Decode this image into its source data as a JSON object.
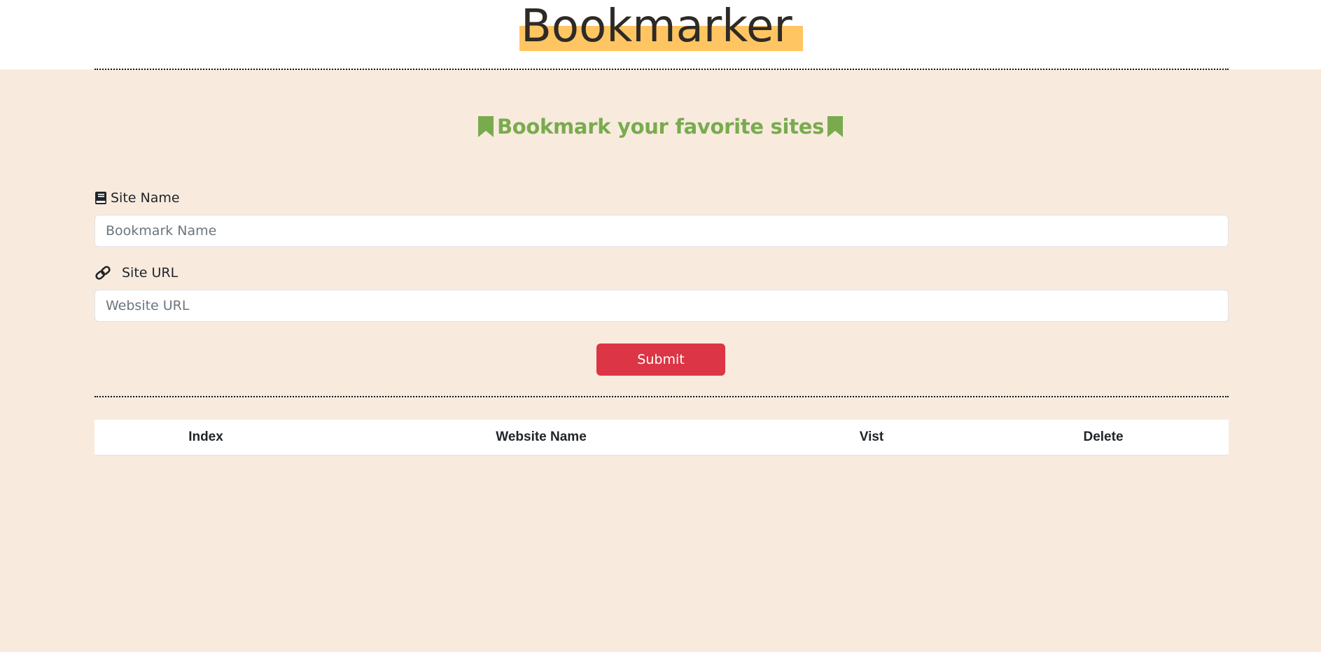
{
  "header": {
    "logo_text": "Bookmarker",
    "highlight_color": "#ffc562"
  },
  "hero": {
    "title": "Bookmark your favorite sites",
    "left_icon": "bookmark-icon",
    "right_icon": "bookmark-icon",
    "accent_color": "#79ab4e"
  },
  "form": {
    "site_name_label": "Site Name",
    "site_name_icon": "book-icon",
    "site_name_placeholder": "Bookmark Name",
    "site_name_value": "",
    "site_url_label": "Site URL",
    "site_url_icon": "link-icon",
    "site_url_placeholder": "Website URL",
    "site_url_value": "",
    "submit_label": "Submit",
    "submit_color": "#dc3545"
  },
  "table": {
    "columns": [
      "Index",
      "Website Name",
      "Vist",
      "Delete"
    ],
    "rows": []
  },
  "colors": {
    "page_background": "#f8ebde"
  }
}
